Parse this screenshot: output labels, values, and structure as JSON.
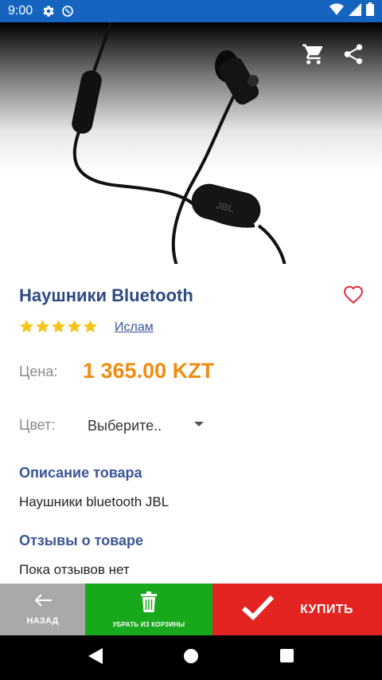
{
  "status_bar": {
    "time": "9:00",
    "icons": [
      "settings-icon",
      "sync-icon",
      "wifi-icon",
      "cellular-icon",
      "battery-icon"
    ]
  },
  "hero": {
    "actions": [
      "cart-icon",
      "share-icon"
    ]
  },
  "product": {
    "title": "Наушники Bluetooth",
    "rating": 5,
    "rating_max": 5,
    "author": "Ислам",
    "price_label": "Цена:",
    "price_value": "1 365.00 KZT",
    "color_label": "Цвет:",
    "color_value": "Выберите.."
  },
  "description": {
    "title": "Описание товара",
    "text": "Наушники bluetooth JBL"
  },
  "reviews": {
    "title": "Отзывы о товаре",
    "text": "Пока отзывов нет"
  },
  "actions": {
    "back_label": "НАЗАД",
    "remove_label": "УБРАТЬ ИЗ КОРЗИНЫ",
    "buy_label": "КУПИТЬ"
  },
  "colors": {
    "status_bar": "#1565c0",
    "title": "#2e4a85",
    "price": "#f08c10",
    "back": "#a9a9a9",
    "remove": "#18a81c",
    "buy": "#e32420",
    "star": "#f5c518"
  }
}
